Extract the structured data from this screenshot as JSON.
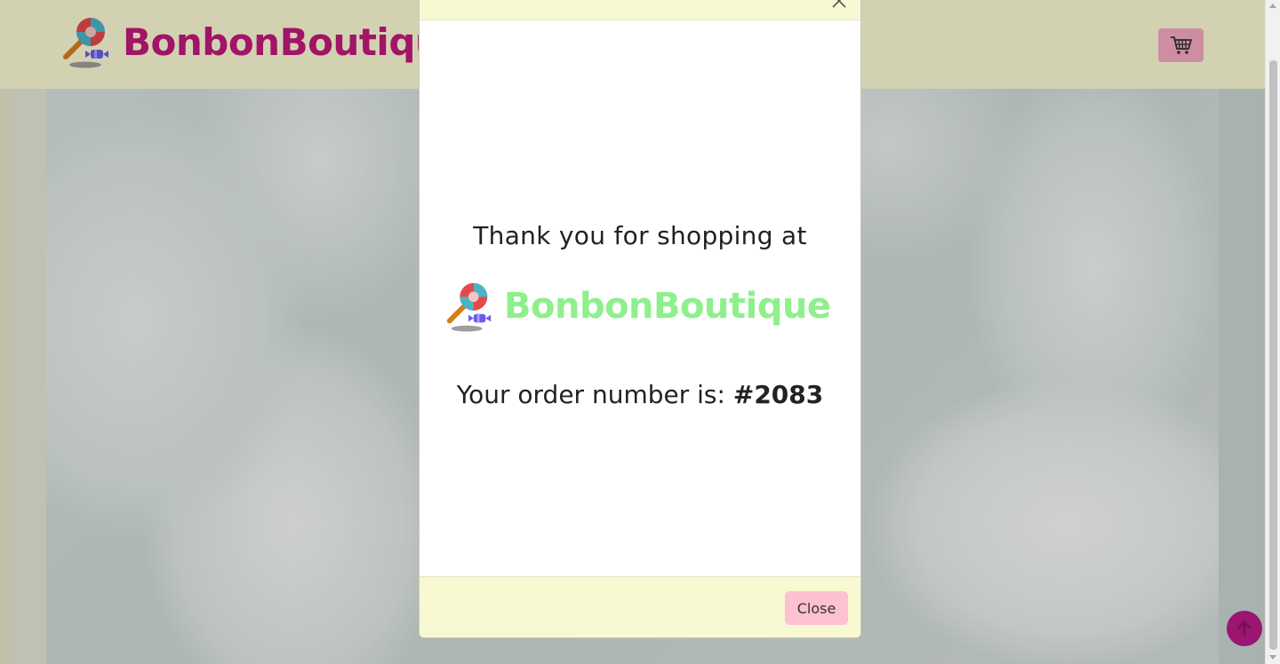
{
  "navbar": {
    "brand_name": "BonbonBoutique",
    "logo_icon": "lollipop-candy-icon",
    "cart_icon": "shopping-cart-icon"
  },
  "modal": {
    "close_icon": "close-icon",
    "thanks_text": "Thank you for shopping at",
    "brand_name": "BonbonBoutique",
    "order_label": "Your order number is:",
    "order_number": "#2083",
    "close_button_label": "Close"
  },
  "floating": {
    "back_to_top_icon": "arrow-up-icon"
  },
  "colors": {
    "brand_pink": "#c2187a",
    "brand_green": "#8ef08c",
    "header_bg": "#fbfbd6",
    "modal_bar_bg": "#f8f8d2",
    "button_pink": "#fec1cf"
  }
}
